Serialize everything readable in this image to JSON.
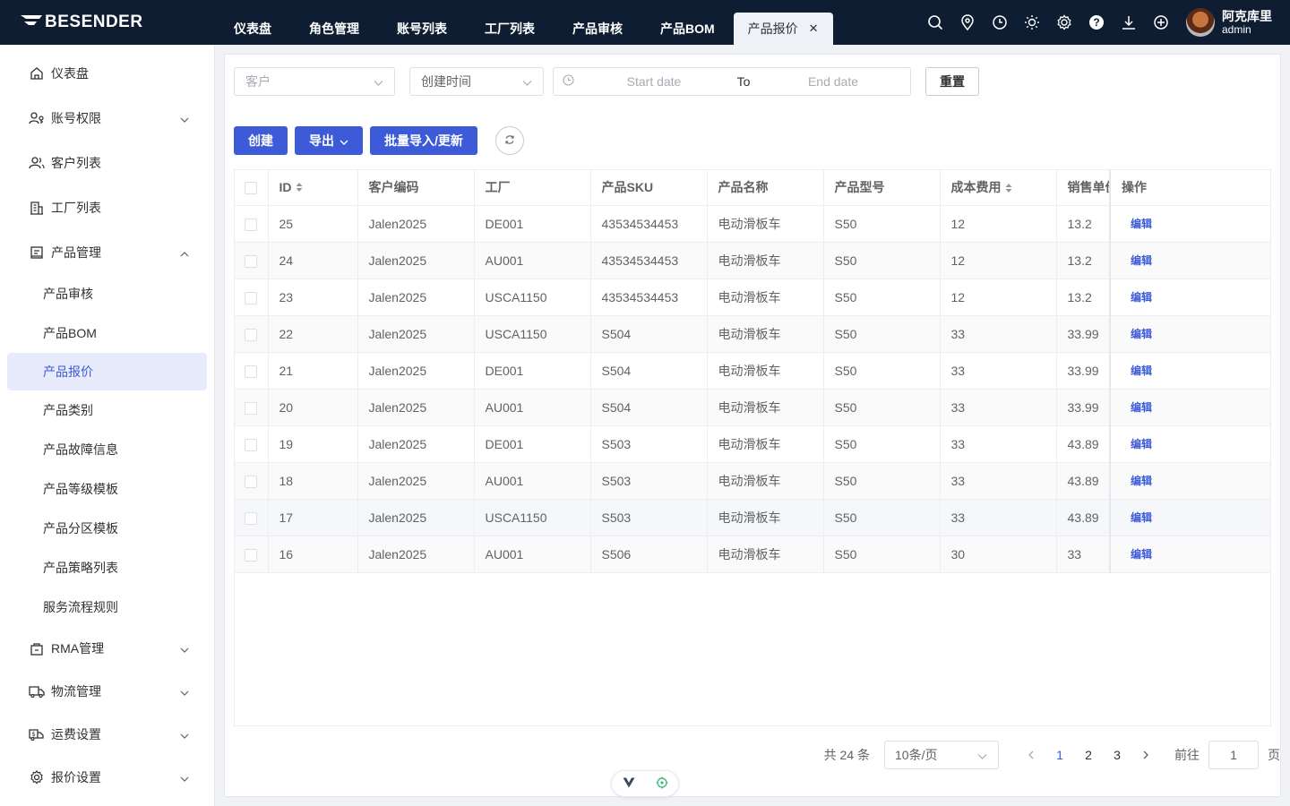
{
  "brand": {
    "name": "BESENDER"
  },
  "tabs": [
    {
      "label": "仪表盘"
    },
    {
      "label": "角色管理"
    },
    {
      "label": "账号列表"
    },
    {
      "label": "工厂列表"
    },
    {
      "label": "产品审核"
    },
    {
      "label": "产品BOM"
    },
    {
      "label": "产品报价",
      "active": true
    }
  ],
  "user": {
    "name": "阿克库里",
    "role": "admin"
  },
  "sidebar": {
    "items": [
      {
        "label": "仪表盘",
        "icon": "home-icon"
      },
      {
        "label": "账号权限",
        "icon": "user-key-icon"
      },
      {
        "label": "客户列表",
        "icon": "users-icon"
      },
      {
        "label": "工厂列表",
        "icon": "building-icon"
      },
      {
        "label": "产品管理",
        "icon": "product-icon"
      }
    ],
    "sub_items": [
      "产品审核",
      "产品BOM",
      "产品报价",
      "产品类别",
      "产品故障信息",
      "产品等级模板",
      "产品分区模板",
      "产品策略列表",
      "服务流程规则"
    ],
    "bottom_items": [
      {
        "label": "RMA管理",
        "icon": "rma-icon"
      },
      {
        "label": "物流管理",
        "icon": "truck-icon"
      },
      {
        "label": "运费设置",
        "icon": "shipping-fee-icon"
      },
      {
        "label": "报价设置",
        "icon": "gear-icon"
      }
    ]
  },
  "filters": {
    "customer_placeholder": "客户",
    "created_time": "创建时间",
    "start_placeholder": "Start date",
    "range_separator": "To",
    "end_placeholder": "End date",
    "reset_label": "重置"
  },
  "actions": {
    "create_label": "创建",
    "export_label": "导出",
    "batch_label": "批量导入/更新"
  },
  "table": {
    "columns": [
      "ID",
      "客户编码",
      "工厂",
      "产品SKU",
      "产品名称",
      "产品型号",
      "成本费用",
      "销售单价",
      "操作"
    ],
    "edit_label": "编辑",
    "rows": [
      {
        "id": "25",
        "customer": "Jalen2025",
        "factory": "DE001",
        "sku": "43534534453",
        "name": "电动滑板车",
        "model": "S50",
        "cost": "12",
        "price": "13.2"
      },
      {
        "id": "24",
        "customer": "Jalen2025",
        "factory": "AU001",
        "sku": "43534534453",
        "name": "电动滑板车",
        "model": "S50",
        "cost": "12",
        "price": "13.2"
      },
      {
        "id": "23",
        "customer": "Jalen2025",
        "factory": "USCA1150",
        "sku": "43534534453",
        "name": "电动滑板车",
        "model": "S50",
        "cost": "12",
        "price": "13.2"
      },
      {
        "id": "22",
        "customer": "Jalen2025",
        "factory": "USCA1150",
        "sku": "S504",
        "name": "电动滑板车",
        "model": "S50",
        "cost": "33",
        "price": "33.99"
      },
      {
        "id": "21",
        "customer": "Jalen2025",
        "factory": "DE001",
        "sku": "S504",
        "name": "电动滑板车",
        "model": "S50",
        "cost": "33",
        "price": "33.99"
      },
      {
        "id": "20",
        "customer": "Jalen2025",
        "factory": "AU001",
        "sku": "S504",
        "name": "电动滑板车",
        "model": "S50",
        "cost": "33",
        "price": "33.99"
      },
      {
        "id": "19",
        "customer": "Jalen2025",
        "factory": "DE001",
        "sku": "S503",
        "name": "电动滑板车",
        "model": "S50",
        "cost": "33",
        "price": "43.89"
      },
      {
        "id": "18",
        "customer": "Jalen2025",
        "factory": "AU001",
        "sku": "S503",
        "name": "电动滑板车",
        "model": "S50",
        "cost": "33",
        "price": "43.89"
      },
      {
        "id": "17",
        "customer": "Jalen2025",
        "factory": "USCA1150",
        "sku": "S503",
        "name": "电动滑板车",
        "model": "S50",
        "cost": "33",
        "price": "43.89"
      },
      {
        "id": "16",
        "customer": "Jalen2025",
        "factory": "AU001",
        "sku": "S506",
        "name": "电动滑板车",
        "model": "S50",
        "cost": "30",
        "price": "33"
      }
    ]
  },
  "pagination": {
    "total_prefix": "共",
    "total": "24",
    "total_suffix": "条",
    "page_size": "10条/页",
    "pages": [
      "1",
      "2",
      "3"
    ],
    "current": "1",
    "goto_prefix": "前往",
    "goto_value": "1",
    "goto_suffix": "页"
  },
  "colors": {
    "primary": "#3d5bd9",
    "header_bg": "#0f1d33"
  }
}
